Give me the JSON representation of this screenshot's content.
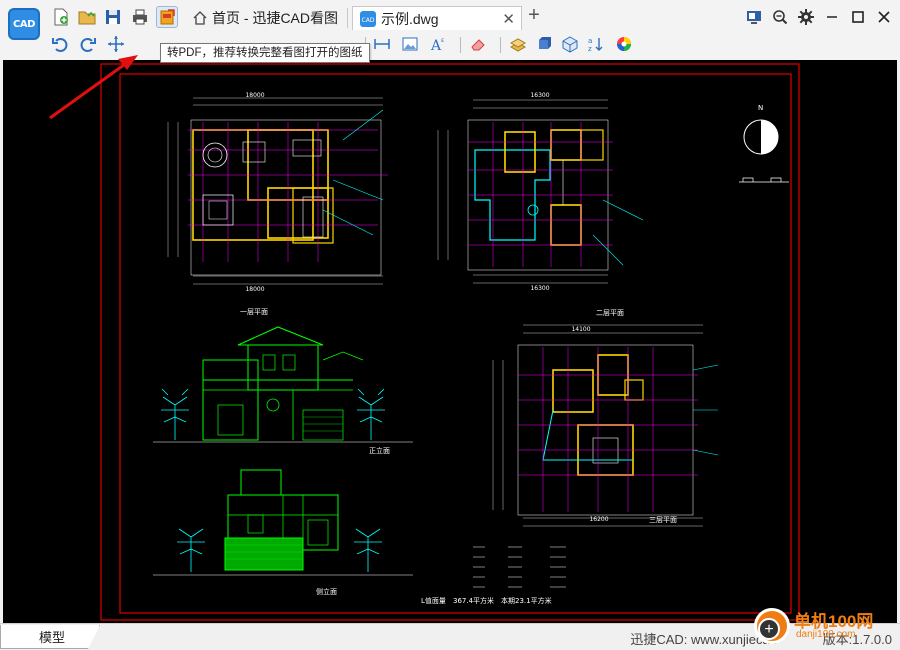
{
  "app": {
    "logo_text": "CAD",
    "brand_color": "#2f8de4"
  },
  "quick_toolbar": {
    "items": [
      {
        "name": "new-file",
        "icon": "new-file-icon"
      },
      {
        "name": "open-file",
        "icon": "open-folder-icon"
      },
      {
        "name": "save",
        "icon": "save-icon"
      },
      {
        "name": "print",
        "icon": "print-icon"
      },
      {
        "name": "to-pdf",
        "icon": "pdf-export-icon"
      }
    ]
  },
  "tabs": [
    {
      "label": "首页 - 迅捷CAD看图",
      "icon": "home-icon",
      "active": false
    },
    {
      "label": "示例.dwg",
      "icon": "cad-file-icon",
      "active": true,
      "close": "✕"
    }
  ],
  "new_tab_symbol": "+",
  "window_controls": [
    "display-settings-icon",
    "zoom-icon",
    "settings-gear-icon",
    "minimize-icon",
    "maximize-icon",
    "close-icon"
  ],
  "tooltip": {
    "text": "转PDF，推荐转换完整看图打开的图纸"
  },
  "drawing": {
    "background": "#000000",
    "frame_color": "#e00000",
    "labels": {
      "first_floor_plan": "一层平面",
      "second_floor_plan": "二层平面",
      "third_floor_plan": "三层平面",
      "front_elevation": "正立面",
      "side_elevation": "侧立面",
      "area_summary_prefix": "L值面量",
      "area_value_1": "367.4平方米",
      "area_summary_mid": "本期23.1平方米",
      "north_label": "N"
    },
    "dims": {
      "plan1_top": "18000",
      "plan1_bottom": "18000",
      "plan2_top": "16300",
      "plan2_bottom": "16300",
      "plan3_top": "14100",
      "plan3_bottom": "16200"
    }
  },
  "statusbar": {
    "model_tab": "模型",
    "site_label": "迅捷CAD: www.xunjiecad",
    "version_label": "版本:1.7.0.0"
  },
  "watermark": {
    "title": "单机100网",
    "sub": "danji100.com"
  },
  "colors": {
    "wall_yellow": "#ffd700",
    "magenta": "#ff00ff",
    "cyan": "#00ffff",
    "green": "#00ff00",
    "white": "#ffffff",
    "arrow_red": "#e01010"
  }
}
